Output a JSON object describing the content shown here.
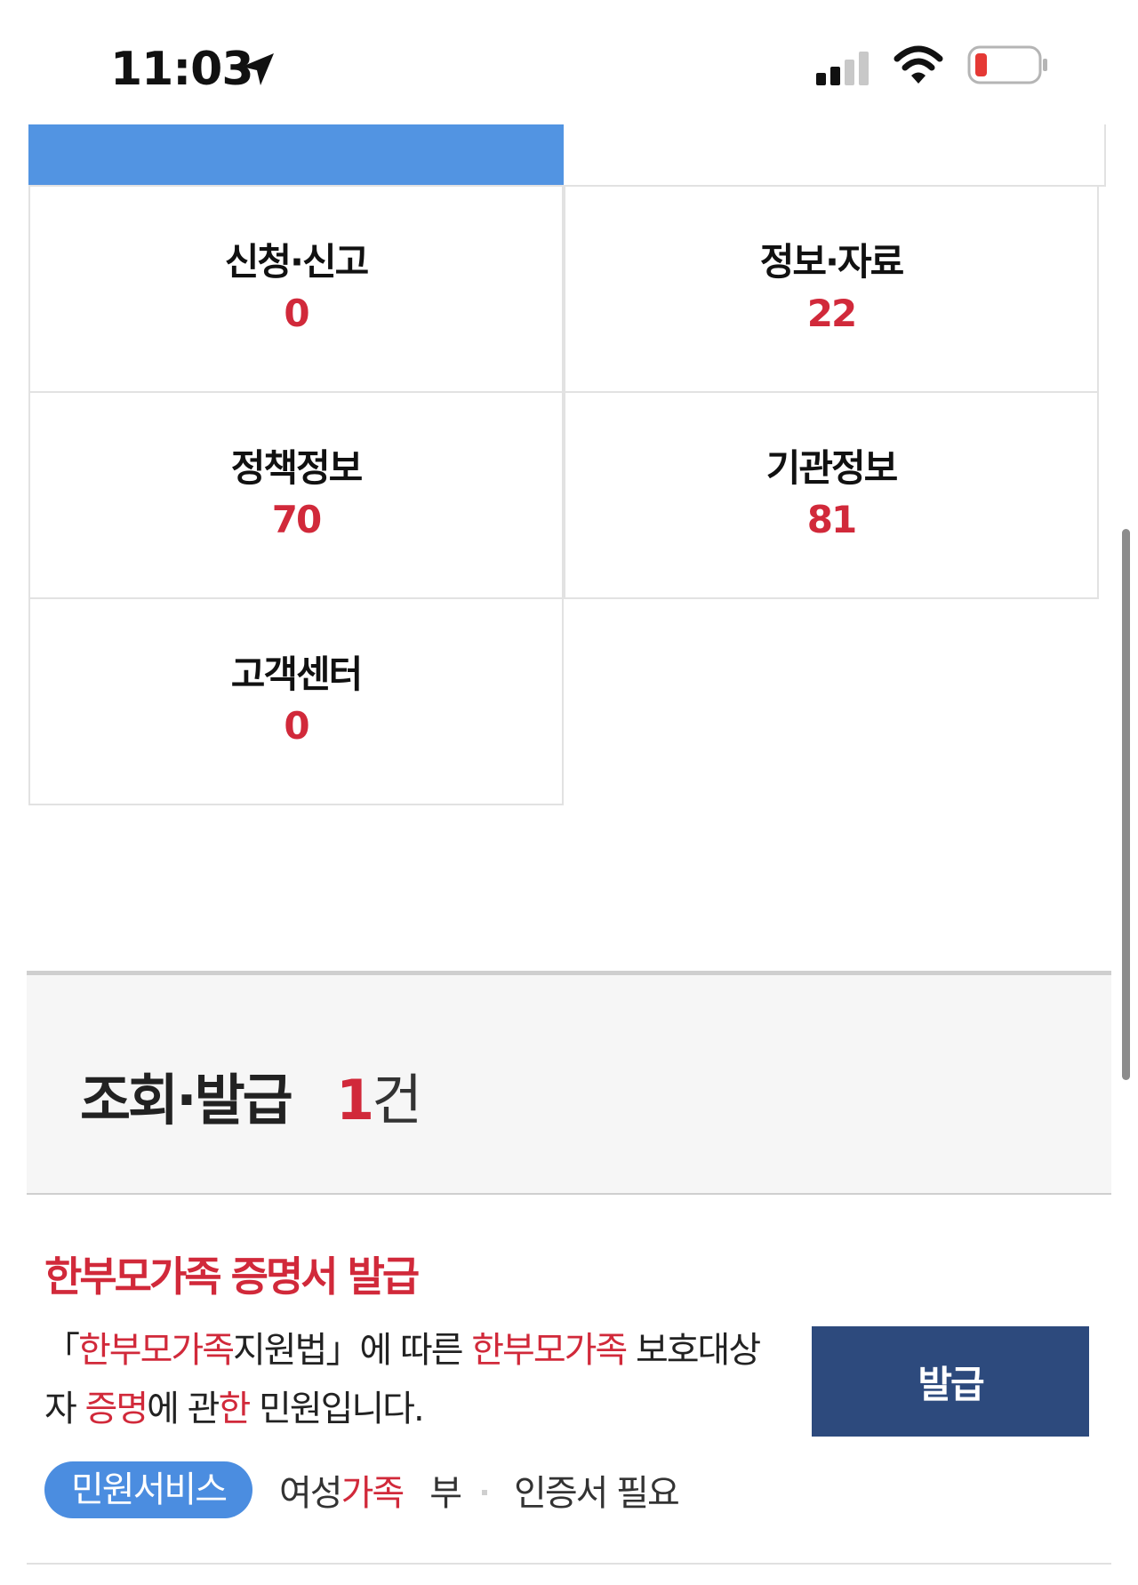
{
  "status_bar": {
    "time": "11:03",
    "icons": [
      "location-arrow-icon",
      "cellular-signal-icon",
      "wifi-icon",
      "battery-low-icon"
    ],
    "battery_color": "#e53935"
  },
  "categories": [
    {
      "label": "신청·신고",
      "count": "0"
    },
    {
      "label": "정보·자료",
      "count": "22"
    },
    {
      "label": "정책정보",
      "count": "70"
    },
    {
      "label": "기관정보",
      "count": "81"
    },
    {
      "label": "고객센터",
      "count": "0"
    }
  ],
  "section": {
    "title": "조회·발급",
    "count": "1",
    "count_unit": "건"
  },
  "result": {
    "title": "한부모가족 증명서 발급",
    "desc": {
      "p1": "「",
      "p2": "한부모가족",
      "p3": "지원법」에 따른 ",
      "p4": "한부모가족",
      "p5": " 보호대상자 ",
      "p6": "증명",
      "p7": "에 관",
      "p8": "한",
      "p9": " 민원입니다."
    },
    "button_label": "발급",
    "tags": {
      "badge": "민원서비스",
      "org_part1": "여성",
      "org_part2": "가족",
      "org_part3": "부",
      "requirement": "인증서 필요"
    }
  },
  "colors": {
    "highlight": "#d1293a",
    "blue_tab": "#5294e2",
    "button": "#2d4a7d",
    "badge": "#4b8de0"
  }
}
